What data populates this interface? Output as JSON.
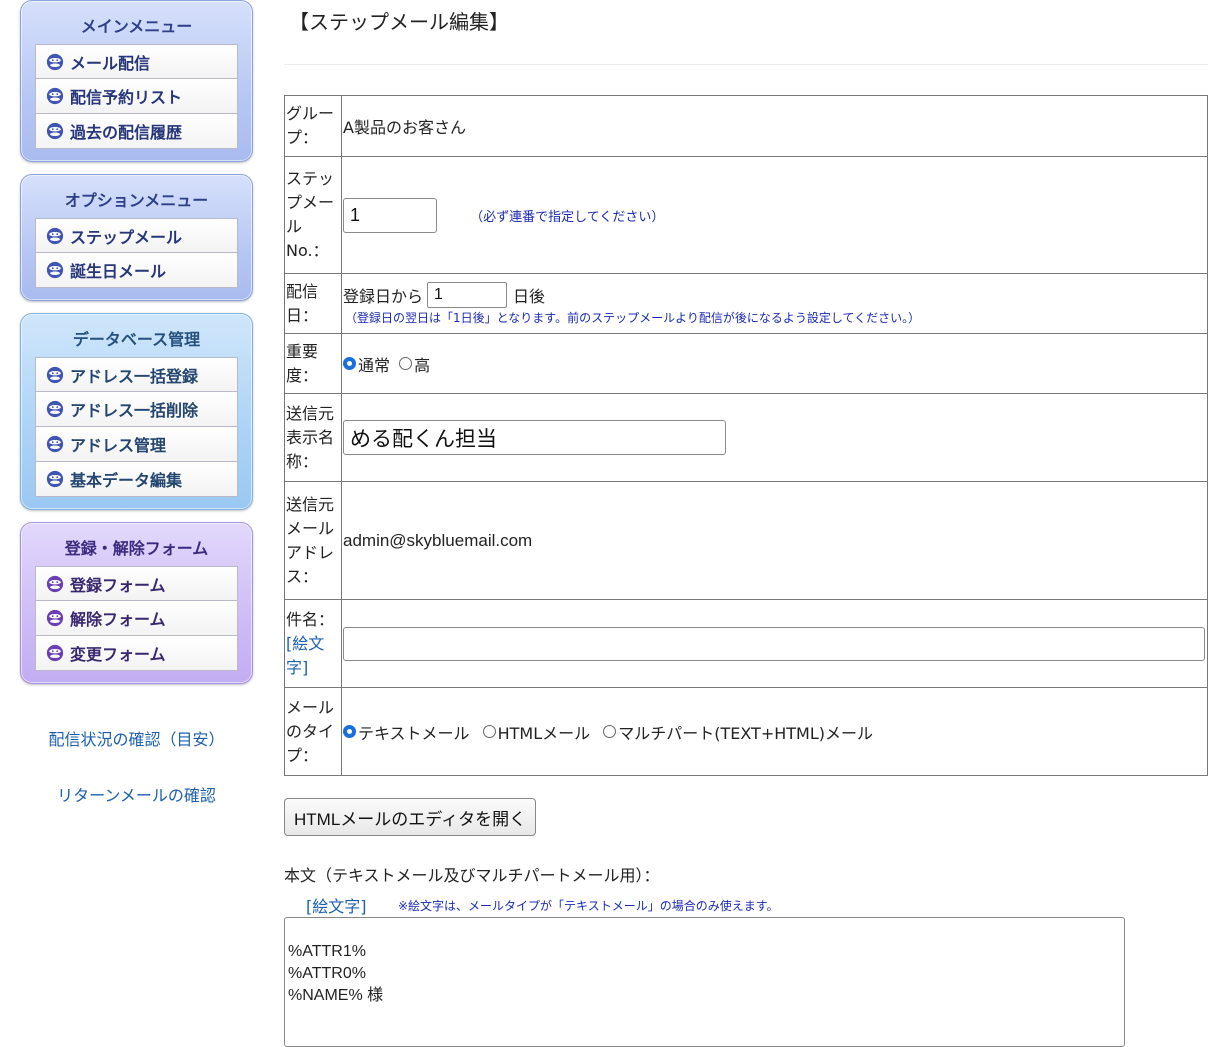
{
  "sidebar": {
    "main_menu": {
      "title": "メインメニュー",
      "items": [
        "メール配信",
        "配信予約リスト",
        "過去の配信履歴"
      ]
    },
    "option_menu": {
      "title": "オプションメニュー",
      "items": [
        "ステップメール",
        "誕生日メール"
      ]
    },
    "db_menu": {
      "title": "データベース管理",
      "items": [
        "アドレス一括登録",
        "アドレス一括削除",
        "アドレス管理",
        "基本データ編集"
      ]
    },
    "form_menu": {
      "title": "登録・解除フォーム",
      "items": [
        "登録フォーム",
        "解除フォーム",
        "変更フォーム"
      ]
    },
    "links": [
      "配信状況の確認（目安）",
      "リターンメールの確認"
    ]
  },
  "page": {
    "title": "【ステップメール編集】"
  },
  "form": {
    "group": {
      "label": "グループ：",
      "value": "A製品のお客さん"
    },
    "step_no": {
      "label": "ステップメールNo.：",
      "value": "1",
      "note": "（必ず連番で指定してください）"
    },
    "delivery_day": {
      "label": "配信日：",
      "prefix": "登録日から",
      "value": "1",
      "suffix": "日後",
      "note": "（登録日の翌日は「1日後」となります。前のステップメールより配信が後になるよう設定してください。）"
    },
    "priority": {
      "label": "重要度：",
      "options": [
        "通常",
        "高"
      ],
      "selected": "通常"
    },
    "sender_name": {
      "label": "送信元表示名称：",
      "value": "める配くん担当"
    },
    "sender_address": {
      "label": "送信元メールアドレス：",
      "value": "admin@skybluemail.com"
    },
    "subject": {
      "label": "件名：",
      "emoji_link": "[絵文字]",
      "value": ""
    },
    "mail_type": {
      "label": "メールのタイプ：",
      "options": [
        "テキストメール",
        "HTMLメール",
        "マルチパート(TEXT+HTML)メール"
      ],
      "selected": "テキストメール"
    }
  },
  "html_editor_button": "HTMLメールのエディタを開く",
  "body": {
    "label": "本文（テキストメール及びマルチパートメール用）：",
    "emoji_link": "[絵文字]",
    "note": "※絵文字は、メールタイプが「テキストメール」の場合のみ使えます。",
    "text": "%ATTR1%\n%ATTR0%\n%NAME% 様"
  },
  "colors": {
    "link": "#1b5fb0",
    "note": "#1b2ab8",
    "radio_selected": "#1a6fe0"
  },
  "icons": {
    "menu_item": "face-icon"
  }
}
